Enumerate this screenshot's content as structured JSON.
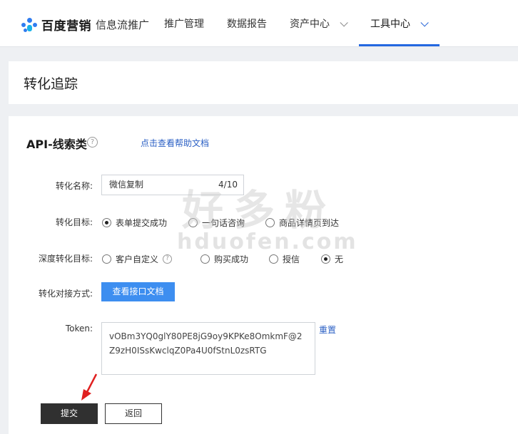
{
  "nav": {
    "logo_brand": "百度营销",
    "logo_sub": "信息流推广",
    "items": [
      {
        "label": "推广管理"
      },
      {
        "label": "数据报告"
      },
      {
        "label": "资产中心"
      },
      {
        "label": "工具中心"
      }
    ]
  },
  "page": {
    "title": "转化追踪"
  },
  "section": {
    "title": "API-线索类",
    "help_link": "点击查看帮助文档"
  },
  "form": {
    "name_label": "转化名称:",
    "name_value": "微信复制",
    "name_count": "4/10",
    "goal_label": "转化目标:",
    "goal_options": [
      "表单提交成功",
      "一句话咨询",
      "商品详情页到达"
    ],
    "goal_selected": "表单提交成功",
    "deep_label": "深度转化目标:",
    "deep_options": [
      "客户自定义",
      "购买成功",
      "授信",
      "无"
    ],
    "deep_selected": "无",
    "method_label": "转化对接方式:",
    "doc_button": "查看接口文档",
    "token_label": "Token:",
    "token_value": "vOBm3YQ0glY80PE8jG9oy9KPKe8OmkmF@2Z9zH0ISsKwclqZ0Pa4U0fStnL0zsRTG",
    "reset_link": "重置"
  },
  "actions": {
    "submit": "提交",
    "back": "返回"
  },
  "watermark": {
    "cn": "好多粉",
    "en": "hduofen.com"
  },
  "colors": {
    "accent": "#2468e0",
    "primary_button": "#3d8ef0",
    "link": "#2a5fc4",
    "submit": "#303030",
    "annotation_arrow": "#e02020"
  }
}
